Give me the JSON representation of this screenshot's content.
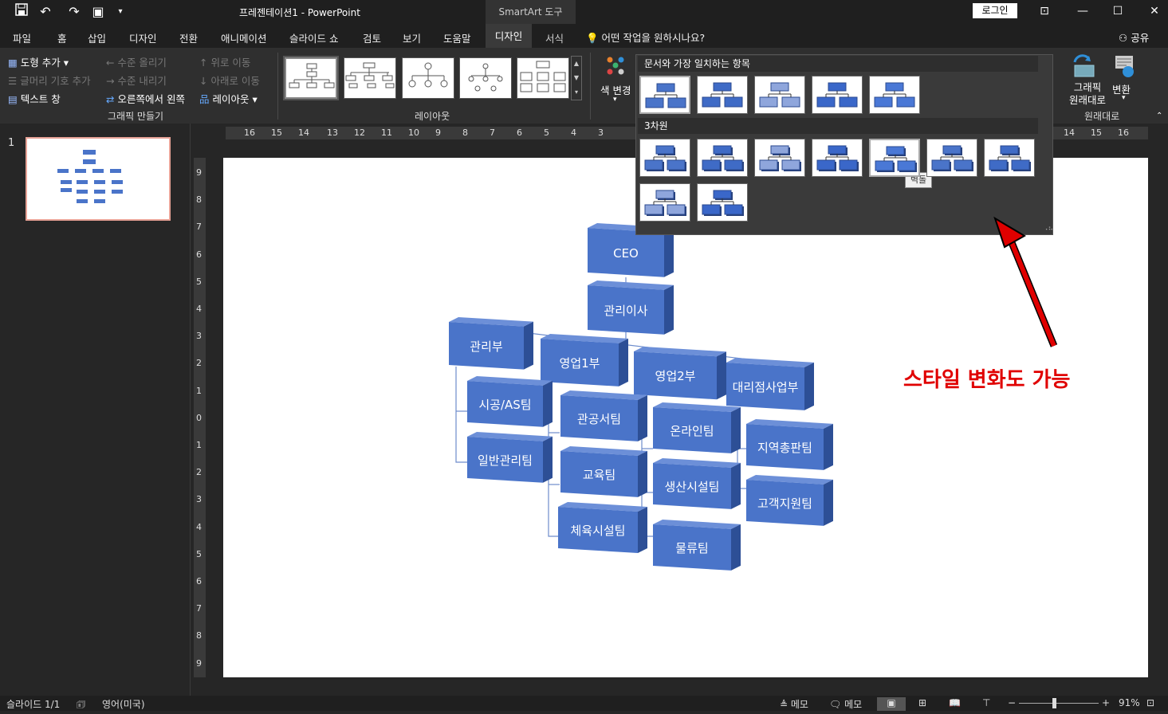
{
  "title_bar": {
    "doc_title": "프레젠테이션1  -  PowerPoint",
    "contextual_tab": "SmartArt 도구",
    "login": "로그인"
  },
  "tabs": [
    "파일",
    "홈",
    "삽입",
    "디자인",
    "전환",
    "애니메이션",
    "슬라이드 쇼",
    "검토",
    "보기",
    "도움말"
  ],
  "active_tab": "디자인",
  "format_tab": "서식",
  "search_hint": "어떤 작업을 원하시나요?",
  "share": "공유",
  "ribbon": {
    "create_graphic": {
      "add_shape": "도형 추가",
      "add_bullet": "글머리 기호 추가",
      "text_pane": "텍스트 창",
      "promote": "수준 올리기",
      "demote": "수준 내리기",
      "right_to_left": "오른쪽에서 왼쪽",
      "move_up": "위로 이동",
      "move_down": "아래로 이동",
      "layout": "레이아웃",
      "group_label": "그래픽 만들기"
    },
    "layouts_group": "레이아웃",
    "change_colors": "색 변경",
    "reset": {
      "reset_graphic": "그래픽\n원래대로",
      "convert": "변환",
      "group_label": "원래대로"
    }
  },
  "styles_popup": {
    "section1": "문서와 가장 일치하는 항목",
    "section2": "3차원",
    "tooltip": "벽돌"
  },
  "ruler_h": [
    "16",
    "15",
    "14",
    "13",
    "12",
    "11",
    "10",
    "9",
    "8",
    "7",
    "6",
    "5",
    "4",
    "3",
    "14",
    "15",
    "16"
  ],
  "ruler_v": [
    "9",
    "8",
    "7",
    "6",
    "5",
    "4",
    "3",
    "2",
    "1",
    "0",
    "1",
    "2",
    "3",
    "4",
    "5",
    "6",
    "7",
    "8",
    "9"
  ],
  "slide_number": "1",
  "org_chart": {
    "ceo": "CEO",
    "director": "관리이사",
    "departments": [
      {
        "name": "관리부",
        "teams": [
          "시공/AS팀",
          "일반관리팀"
        ]
      },
      {
        "name": "영업1부",
        "teams": [
          "관공서팀",
          "교육팀",
          "체육시설팀"
        ]
      },
      {
        "name": "영업2부",
        "teams": [
          "온라인팀",
          "생산시설팀",
          "물류팀"
        ]
      },
      {
        "name": "대리점사업부",
        "teams": [
          "지역총판팀",
          "고객지원팀"
        ]
      }
    ]
  },
  "annotation": "스타일 변화도 가능",
  "status": {
    "slide_info": "슬라이드 1/1",
    "language": "영어(미국)",
    "notes1": "메모",
    "notes2": "메모",
    "zoom": "91%"
  },
  "colors": {
    "box": "#4a74c9",
    "box_side": "#2d4f96",
    "box_top": "#6c8fd8",
    "accent": "#e00000"
  }
}
